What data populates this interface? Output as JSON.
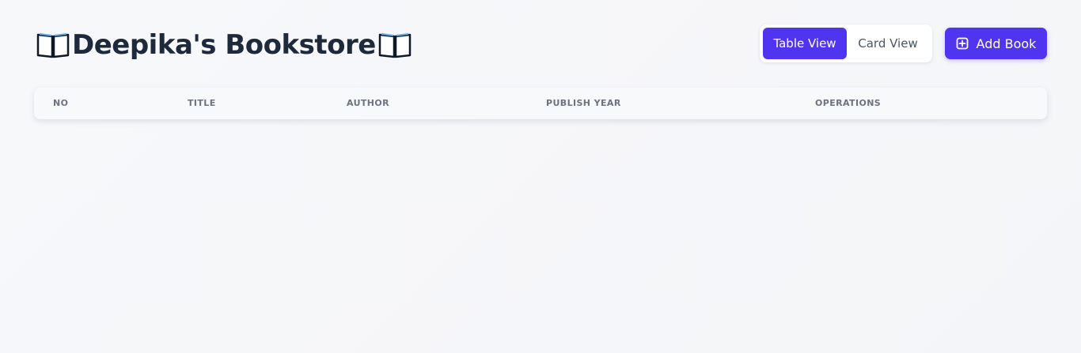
{
  "header": {
    "title": "Deepika's Bookstore",
    "title_icon_left": "open-book-icon",
    "title_icon_right": "open-book-icon"
  },
  "view_toggle": {
    "table_label": "Table View",
    "card_label": "Card View",
    "selected": "Table View"
  },
  "actions": {
    "add_book_label": "Add Book",
    "add_book_icon": "plus-square-icon"
  },
  "table": {
    "columns": [
      "NO",
      "TITLE",
      "AUTHOR",
      "PUBLISH YEAR",
      "OPERATIONS"
    ],
    "rows": []
  },
  "colors": {
    "accent": "#4f35f0",
    "title": "#1e293b",
    "header_text": "#6b7280",
    "background": "#f6f7f9"
  }
}
